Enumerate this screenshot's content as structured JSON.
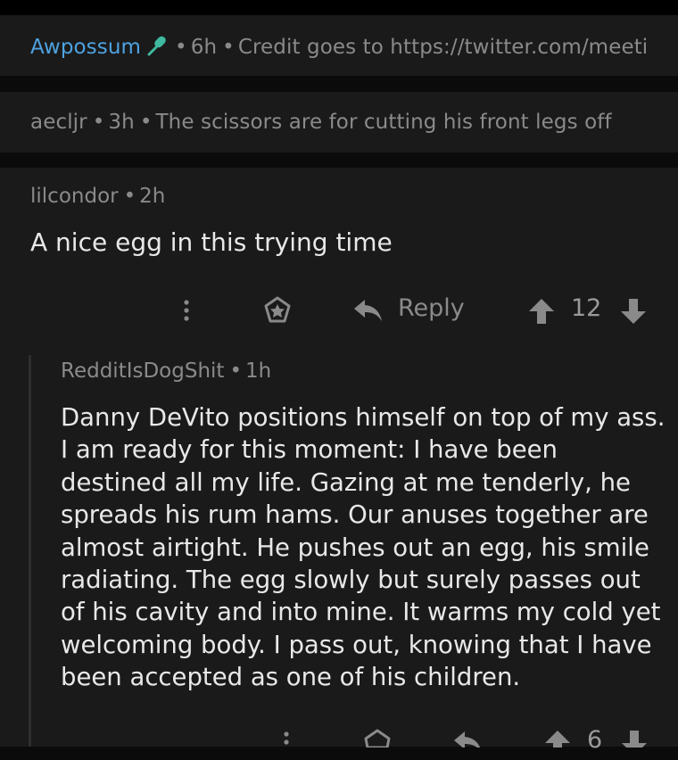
{
  "comments": [
    {
      "user": "Awpossum",
      "time": "6h",
      "text": "Credit goes to https://twitter.com/meeti",
      "collapsed": true,
      "user_color": "#4ea2e0"
    },
    {
      "user": "aecljr",
      "time": "3h",
      "text": "The scissors are for cutting his front legs off",
      "collapsed": true
    },
    {
      "user": "lilcondor",
      "time": "2h",
      "text": "A nice egg in this trying time",
      "reply_label": "Reply",
      "score": "12"
    },
    {
      "user": "RedditIsDogShit",
      "time": "1h",
      "text": "Danny DeVito positions himself on top of my ass. I am ready for this moment: I have been destined all my life. Gazing at me tenderly, he spreads his rum hams. Our anuses together are almost airtight. He pushes out an egg, his smile radiating. The egg slowly but surely passes out of his cavity and into mine. It warms my cold yet welcoming body. I pass out, knowing that I have been accepted as one of his children.",
      "score": "6"
    }
  ],
  "separator": "•",
  "icons": {
    "mic": "microphone-icon",
    "more": "more-vertical-icon",
    "save": "save-icon",
    "reply": "reply-arrow-icon",
    "upvote": "upvote-arrow-icon",
    "downvote": "downvote-arrow-icon"
  },
  "colors": {
    "background": "#0b0b0b",
    "card": "#1a1a1b",
    "meta_text": "#8a8a8a",
    "body_text": "#e8e8e8",
    "username_accent": "#4ea2e0",
    "mic_icon": "#3fb9a0"
  }
}
